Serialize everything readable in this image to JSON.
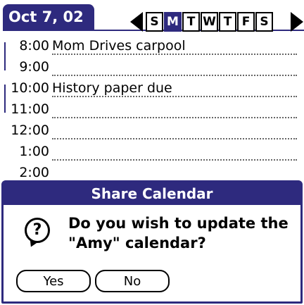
{
  "header": {
    "date": "Oct 7, 02",
    "days": [
      "S",
      "M",
      "T",
      "W",
      "T",
      "F",
      "S"
    ],
    "selected_day_index": 1
  },
  "schedule": [
    {
      "time": "8:00",
      "event": "Mom Drives carpool"
    },
    {
      "time": "9:00",
      "event": ""
    },
    {
      "time": "10:00",
      "event": "History paper due"
    },
    {
      "time": "11:00",
      "event": ""
    },
    {
      "time": "12:00",
      "event": ""
    },
    {
      "time": "1:00",
      "event": ""
    },
    {
      "time": "2:00",
      "event": ""
    }
  ],
  "dialog": {
    "title": "Share Calendar",
    "icon": "question-icon",
    "icon_glyph": "?",
    "message": "Do you wish to update the \"Amy\" calendar?",
    "yes_label": "Yes",
    "no_label": "No"
  },
  "colors": {
    "accent": "#2e2a7e"
  }
}
